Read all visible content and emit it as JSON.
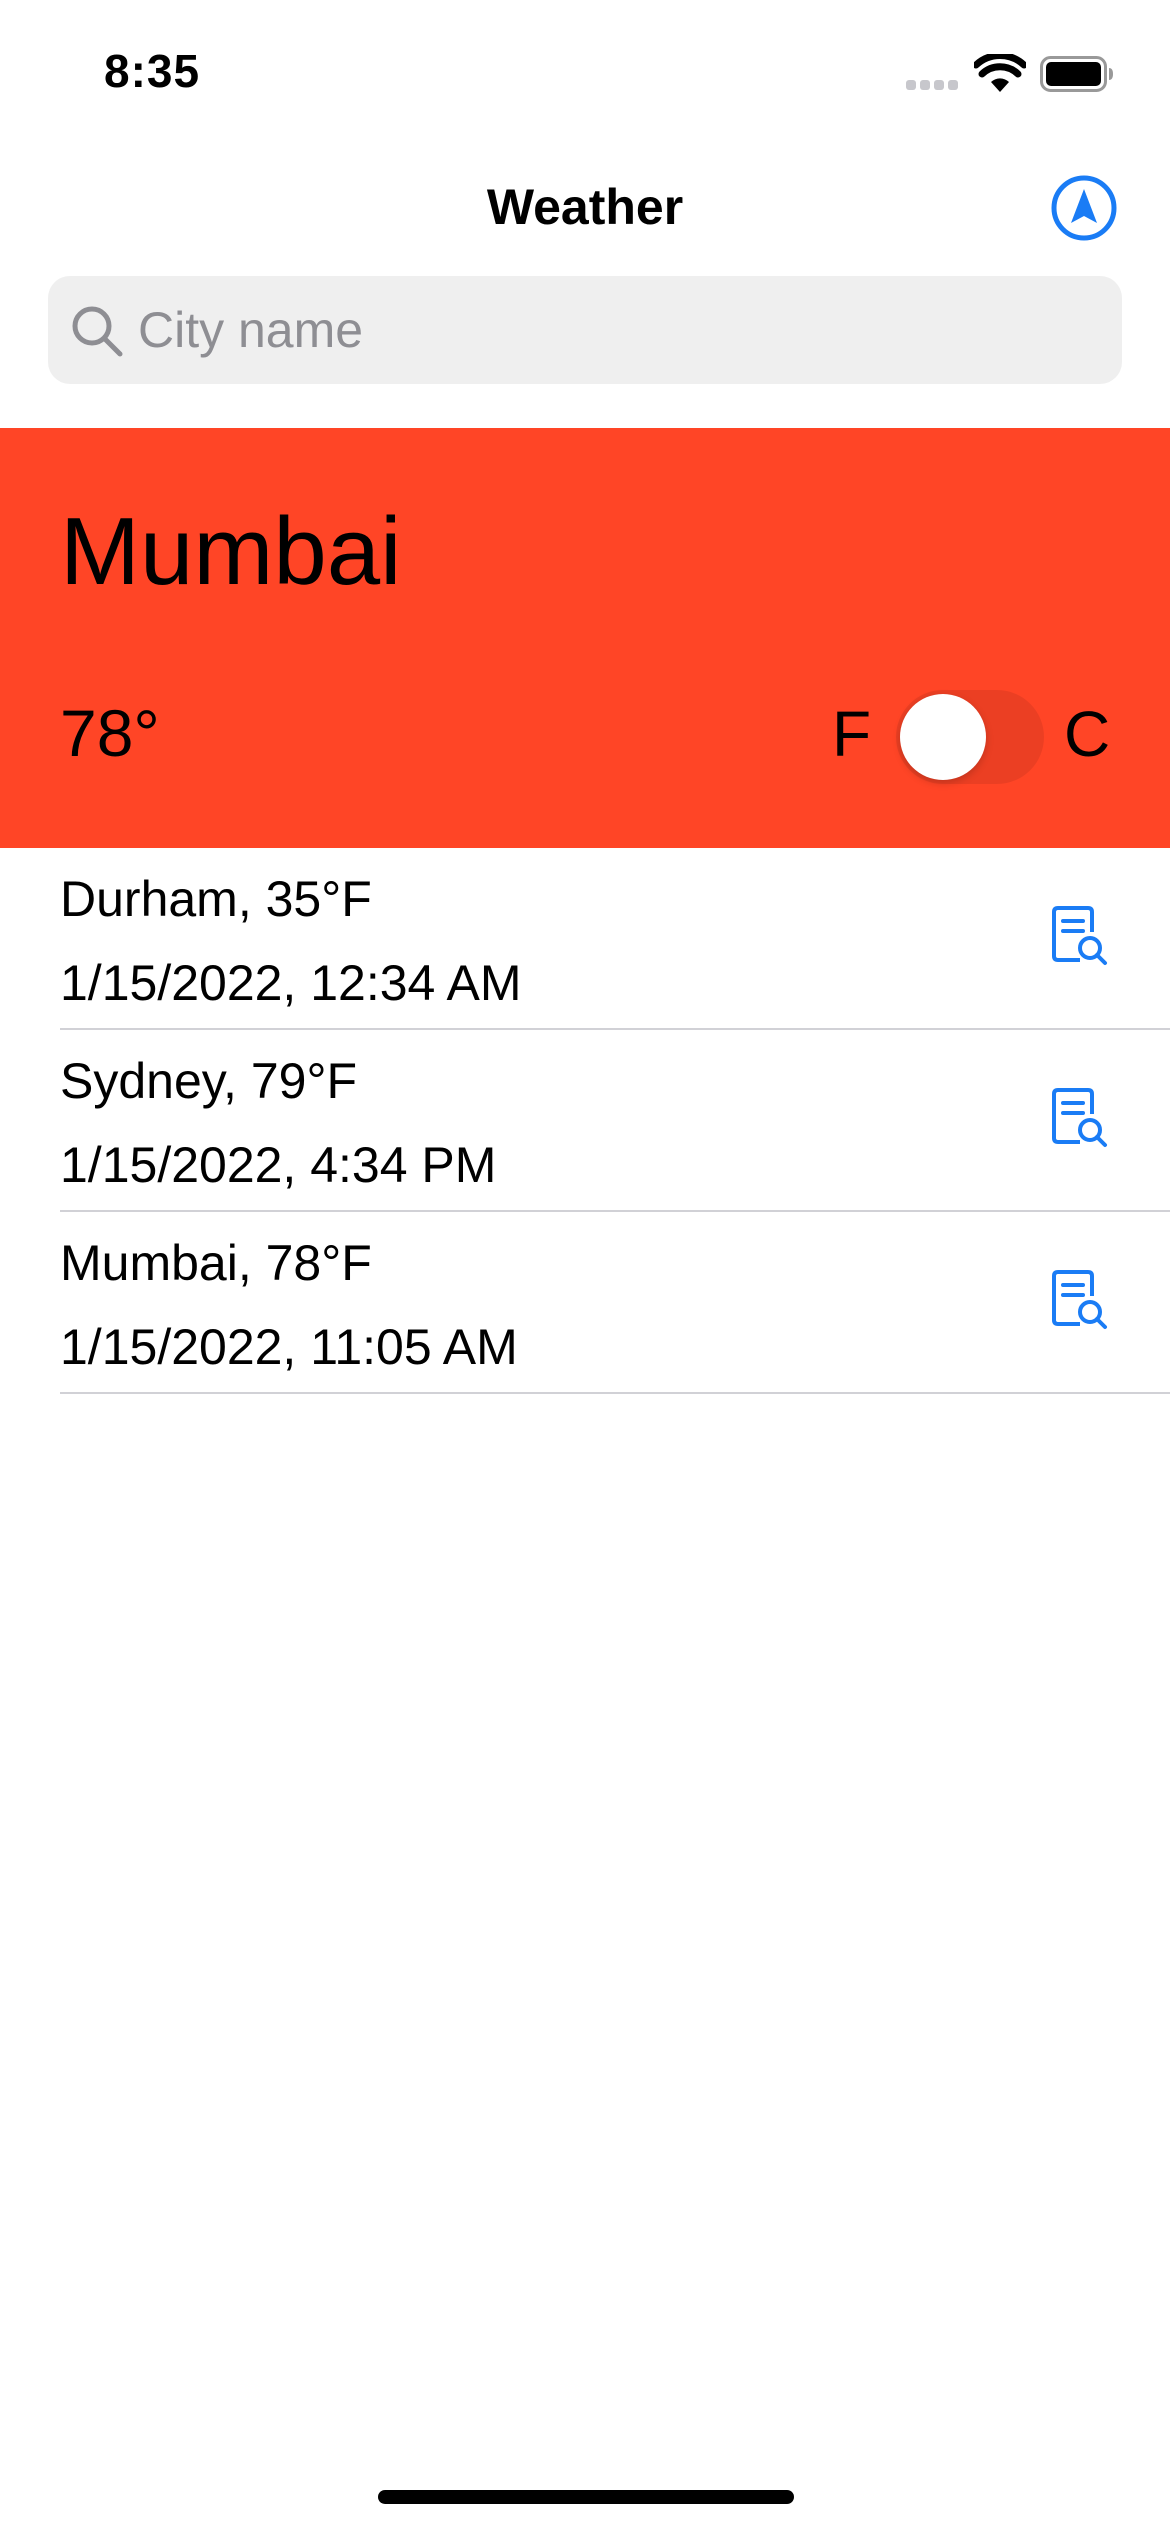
{
  "status_bar": {
    "time": "8:35"
  },
  "nav": {
    "title": "Weather",
    "location_icon": "location-arrow-icon"
  },
  "search": {
    "placeholder": "City name",
    "value": "",
    "icon": "search-icon"
  },
  "current": {
    "city": "Mumbai",
    "temperature": "78°",
    "unit_left": "F",
    "unit_right": "C",
    "unit_toggle_on": false,
    "background_color": "#ff4526"
  },
  "history": [
    {
      "title": "Durham, 35°F",
      "subtitle": "1/15/2022, 12:34 AM",
      "icon": "document-search-icon"
    },
    {
      "title": "Sydney, 79°F",
      "subtitle": "1/15/2022, 4:34 PM",
      "icon": "document-search-icon"
    },
    {
      "title": "Mumbai, 78°F",
      "subtitle": "1/15/2022, 11:05 AM",
      "icon": "document-search-icon"
    }
  ],
  "colors": {
    "accent": "#1a7cf5",
    "card": "#ff4526",
    "separator": "#d1d1d6"
  }
}
